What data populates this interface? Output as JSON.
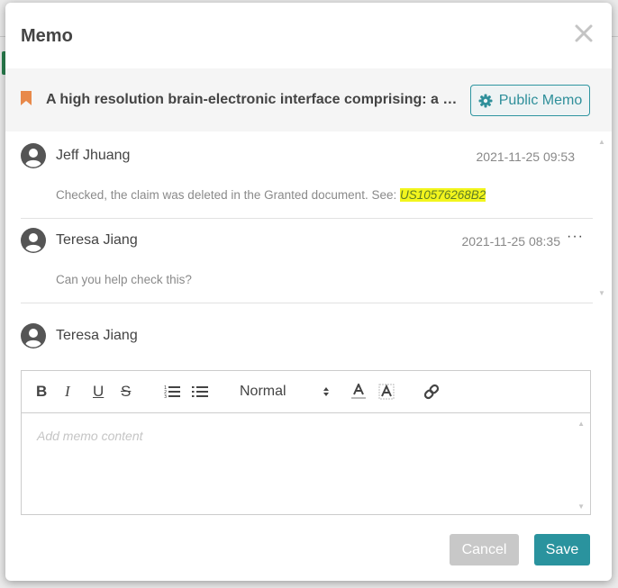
{
  "modal": {
    "title": "Memo",
    "document_title": "A high resolution brain-electronic interface comprising: a semic...",
    "public_memo_label": "Public Memo",
    "colors": {
      "accent": "#2a939e",
      "bookmark": "#e8894a",
      "highlight": "#f2f51d"
    }
  },
  "comments": [
    {
      "author": "Jeff Jhuang",
      "timestamp": "2021-11-25 09:53",
      "text": "Checked, the claim was deleted in the Granted document. See: ",
      "highlight": "US10576268B2"
    },
    {
      "author": "Teresa Jiang",
      "timestamp": "2021-11-25 08:35",
      "text": "Can you help check this?",
      "more_label": "···"
    }
  ],
  "composer": {
    "author": "Teresa Jiang",
    "toolbar": {
      "bold": "B",
      "italic": "I",
      "underline": "U",
      "strike": "S",
      "format_value": "Normal"
    },
    "placeholder": "Add memo content"
  },
  "footer": {
    "cancel_label": "Cancel",
    "save_label": "Save"
  }
}
